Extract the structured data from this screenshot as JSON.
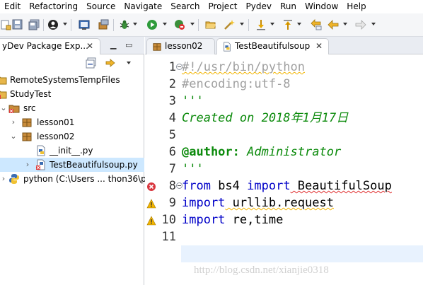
{
  "menu": {
    "items": [
      "Edit",
      "Refactoring",
      "Source",
      "Navigate",
      "Search",
      "Project",
      "Pydev",
      "Run",
      "Window",
      "Help"
    ]
  },
  "toolbar": {
    "icons": [
      "new-icon",
      "save-icon",
      "save-all-icon",
      "profile-icon",
      "console-icon",
      "package-icon",
      "debug-icon",
      "run-icon",
      "stop-debug-icon",
      "open-folder-icon",
      "wand-icon",
      "next-annotation-icon",
      "prev-annotation-icon",
      "back-icon",
      "forward-icon"
    ]
  },
  "left_panel": {
    "tab_label": "PyDev Package Exp...",
    "tab_label_visible": "yDev Package Exp...",
    "close": "✕",
    "tree": [
      {
        "label": "RemoteSystemsTempFiles",
        "icon": "project-icon",
        "level": 0
      },
      {
        "label": "StudyTest",
        "icon": "project-error-icon",
        "level": 0
      },
      {
        "label": "src",
        "icon": "source-folder-error-icon",
        "level": 1,
        "expanded": true
      },
      {
        "label": "lesson01",
        "icon": "package-icon",
        "level": 2,
        "expanded": false
      },
      {
        "label": "lesson02",
        "icon": "package-icon",
        "level": 2,
        "expanded": true
      },
      {
        "label": "__init__.py",
        "icon": "python-file-icon",
        "level": 3
      },
      {
        "label": "TestBeautifulsoup.py",
        "icon": "python-file-error-icon",
        "level": 3,
        "selected": true
      },
      {
        "label": "python  (C:\\Users ... thon36\\p",
        "icon": "python-interpreter-icon",
        "level": 1,
        "expanded": false
      }
    ]
  },
  "editor": {
    "tabs": [
      {
        "label": "lesson02",
        "icon": "package-icon",
        "active": false
      },
      {
        "label": "TestBeautifulsoup",
        "icon": "python-file-icon",
        "active": true,
        "close": "✕"
      }
    ],
    "lines": [
      {
        "num": "1",
        "text": "#!/usr/bin/python"
      },
      {
        "num": "2",
        "text": "#encoding:utf-8"
      },
      {
        "num": "3",
        "text": "'''"
      },
      {
        "num": "4",
        "text": "Created on 2018年1月17日"
      },
      {
        "num": "5",
        "text": ""
      },
      {
        "num": "6",
        "text": "@author: Administrator"
      },
      {
        "num": "7",
        "text": "'''"
      },
      {
        "num": "8",
        "text": "from bs4 import BeautifulSoup"
      },
      {
        "num": "9",
        "text": "import urllib.request"
      },
      {
        "num": "10",
        "text": "import re,time"
      },
      {
        "num": "11",
        "text": ""
      }
    ],
    "tokens": {
      "l1": "#!/usr/bin/python",
      "l2": "#encoding:utf-8",
      "l3": "'''",
      "l4": "Created on 2018年1月17日",
      "l6a": "@author:",
      "l6b": " Administrator",
      "l7": "'''",
      "l8kw1": "from",
      "l8a": " bs4 ",
      "l8kw2": "import",
      "l8b": " BeautifulSoup",
      "l9kw": "import",
      "l9a": " urllib.request",
      "l10kw": "import",
      "l10a": " re,time"
    },
    "annotations": {
      "line8": "error-icon",
      "line9": "warning-icon",
      "line10": "warning-icon"
    }
  },
  "watermark": "http://blog.csdn.net/xianjie0318",
  "colors": {
    "keyword": "#0000c8",
    "string": "#0b8a0b",
    "comment": "#a0a0a0",
    "selection": "#cde8ff",
    "current_line": "#e8f2fe"
  }
}
